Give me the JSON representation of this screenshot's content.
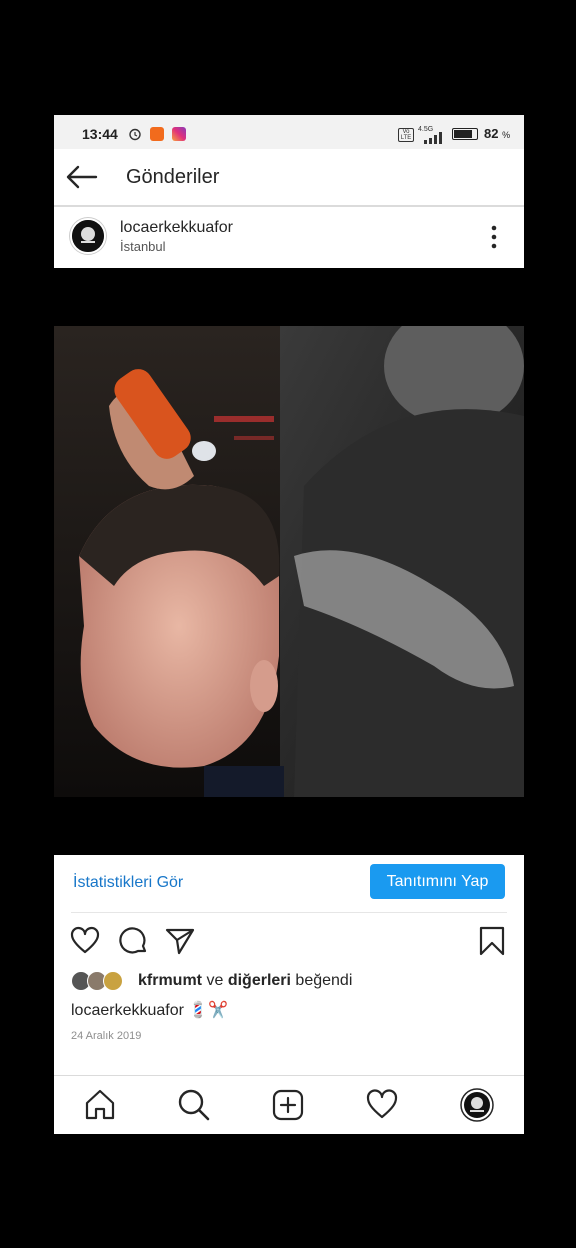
{
  "status_bar": {
    "time": "13:44",
    "network": "4.5G",
    "battery_percent": "82",
    "battery_unit": "%"
  },
  "header": {
    "title": "Gönderiler"
  },
  "post": {
    "username": "locaerkekkuafor",
    "location": "İstanbul",
    "stats_link": "İstatistikleri Gör",
    "promote_label": "Tanıtımını Yap",
    "liked_by_user": "kfrmumt",
    "liked_by_conj": "ve",
    "liked_by_others": "diğerleri",
    "liked_by_suffix": "beğendi",
    "caption_user": "locaerkekkuafor",
    "caption_emoji": "💈✂️",
    "date": "24 Aralık 2019"
  },
  "colors": {
    "accent": "#1a9af0",
    "link": "#1877c9"
  },
  "icons": [
    "back-arrow-icon",
    "more-vertical-icon",
    "heart-icon",
    "comment-icon",
    "share-icon",
    "bookmark-icon",
    "home-icon",
    "search-icon",
    "add-post-icon",
    "activity-heart-icon",
    "profile-avatar-icon"
  ]
}
